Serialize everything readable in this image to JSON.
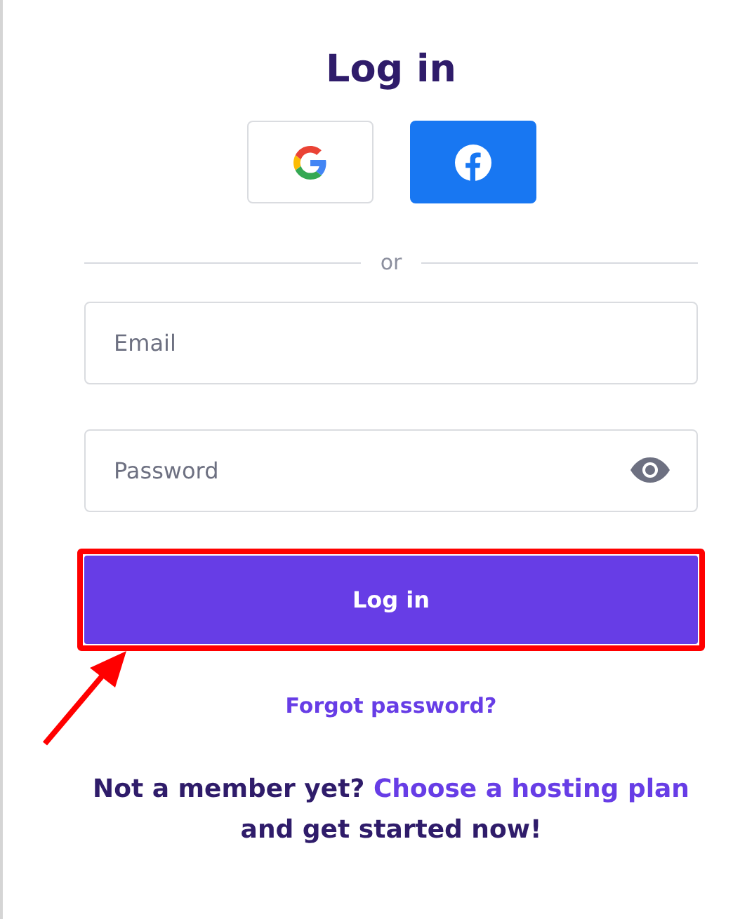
{
  "title": "Log in",
  "social_buttons": [
    {
      "kind": "google"
    },
    {
      "kind": "facebook"
    }
  ],
  "divider_text": "or",
  "email_field": {
    "placeholder": "Email"
  },
  "password_field": {
    "placeholder": "Password",
    "show_toggle": true
  },
  "login_button": {
    "label": "Log in",
    "highlighted": true
  },
  "forgot_link": "Forgot password?",
  "footer": {
    "text": "Not a member yet?",
    "link": "Choose a hosting plan",
    "text_after": "and get started now!"
  }
}
